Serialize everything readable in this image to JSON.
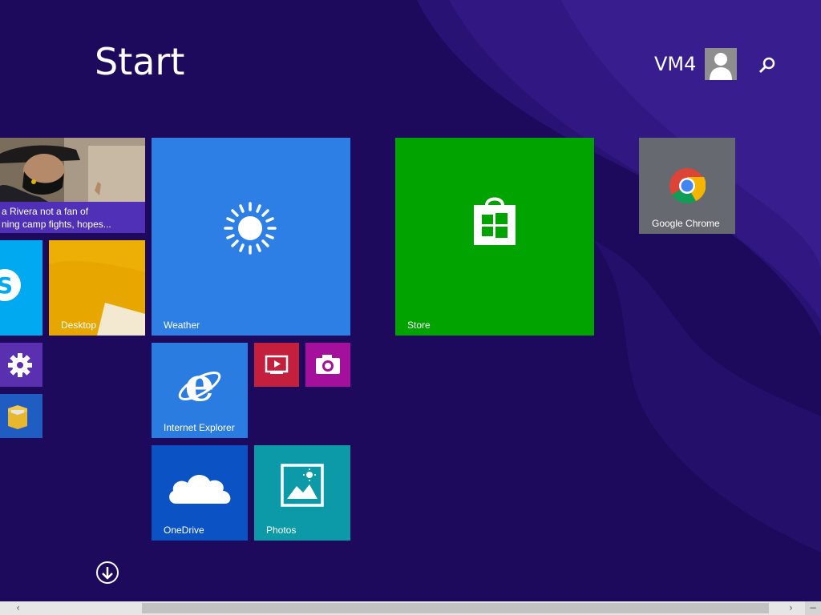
{
  "header": {
    "title": "Start",
    "user_name": "VM4"
  },
  "tiles": {
    "news": {
      "headline_line1": "a Rivera not a fan of",
      "headline_line2": "ning camp fights, hopes..."
    },
    "desktop": {
      "label": "Desktop"
    },
    "weather": {
      "label": "Weather"
    },
    "store": {
      "label": "Store"
    },
    "chrome": {
      "label": "Google Chrome"
    },
    "ie": {
      "label": "Internet Explorer"
    },
    "onedrive": {
      "label": "OneDrive"
    },
    "photos": {
      "label": "Photos"
    }
  },
  "colors": {
    "background": "#1d0a5c",
    "weather": "#2d7fe6",
    "store": "#00a300",
    "chrome": "#666a70",
    "ie": "#2b7ce0",
    "onedrive": "#0b52c4",
    "photos": "#0d9aa8",
    "skype": "#00a9f0",
    "desktop": "#e8a600",
    "video": "#c4203e",
    "camera": "#a4109c",
    "settings": "#5a2fb0",
    "explorer": "#1f5dc2"
  },
  "icons": {
    "search": "search-icon",
    "down": "arrow-down-icon"
  }
}
